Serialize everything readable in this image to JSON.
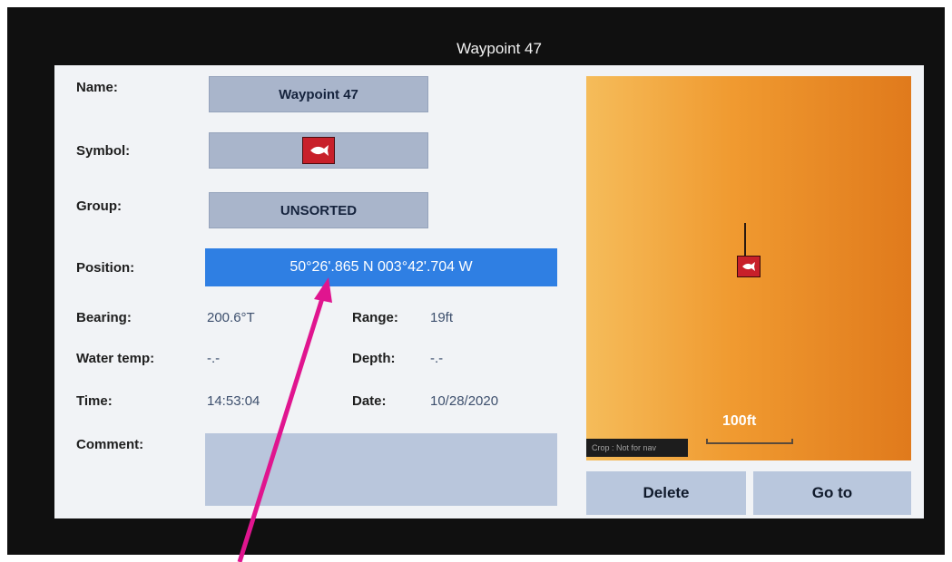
{
  "window": {
    "title": "Waypoint 47"
  },
  "form": {
    "name_label": "Name:",
    "name_value": "Waypoint 47",
    "symbol_label": "Symbol:",
    "symbol_icon": "fish-icon",
    "group_label": "Group:",
    "group_value": "UNSORTED",
    "position_label": "Position:",
    "position_value": "50°26'.865 N  003°42'.704 W",
    "bearing_label": "Bearing:",
    "bearing_value": "200.6°T",
    "range_label": "Range:",
    "range_value": "19ft",
    "water_temp_label": "Water temp:",
    "water_temp_value": "-.-",
    "depth_label": "Depth:",
    "depth_value": "-.-",
    "time_label": "Time:",
    "time_value": "14:53:04",
    "date_label": "Date:",
    "date_value": "10/28/2020",
    "comment_label": "Comment:",
    "comment_value": ""
  },
  "map": {
    "scale_label": "100ft",
    "crop_note": "Crop : Not for nav",
    "marker_icon": "fish-icon"
  },
  "buttons": {
    "delete_label": "Delete",
    "goto_label": "Go to"
  },
  "colors": {
    "position_highlight": "#2f7fe3",
    "annotation_arrow": "#e0158f",
    "map_bg": "#f09a30"
  }
}
